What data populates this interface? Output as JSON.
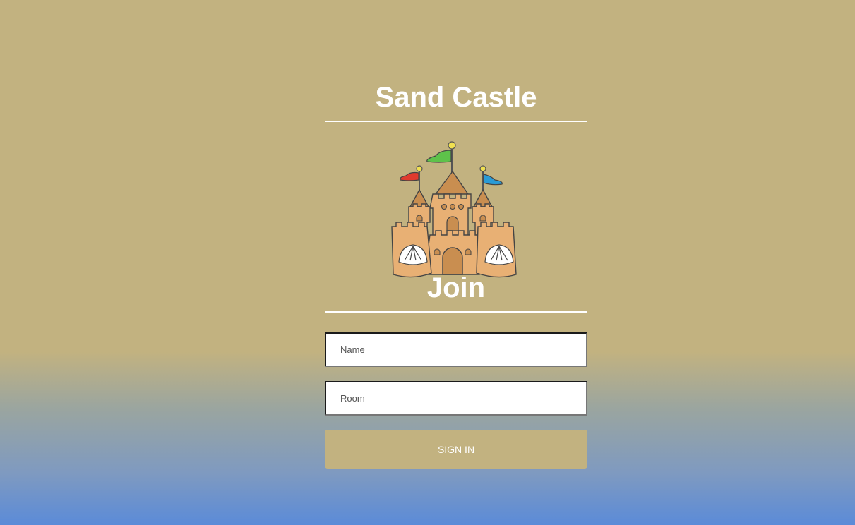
{
  "app": {
    "title": "Sand Castle"
  },
  "logo": {
    "icon": "sand-castle-icon"
  },
  "form": {
    "heading": "Join",
    "name_placeholder": "Name",
    "room_placeholder": "Room",
    "submit_label": "SIGN IN"
  },
  "colors": {
    "sand": "#c2b280",
    "sky_blue": "#5b8bd8",
    "castle": "#e8b074"
  }
}
